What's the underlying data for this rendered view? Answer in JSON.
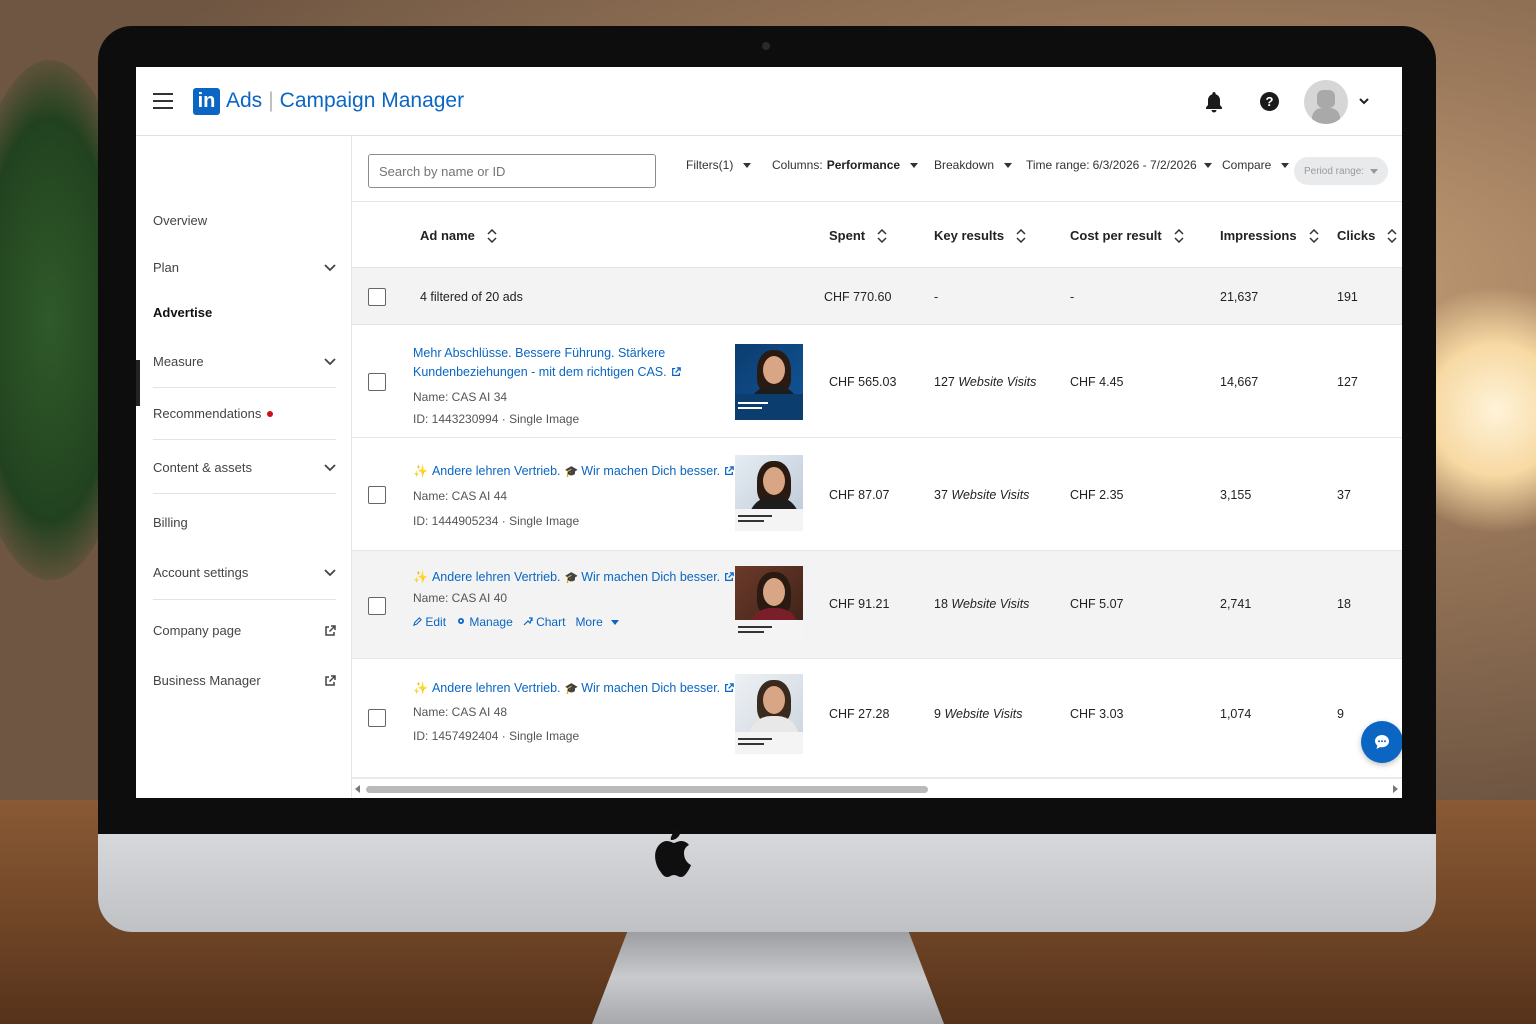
{
  "header": {
    "logo_text": "in",
    "brand_ads": "Ads",
    "brand_separator": "|",
    "brand_title": "Campaign Manager",
    "help_glyph": "?",
    "icons": [
      "menu-icon",
      "bell-icon",
      "help-icon",
      "avatar",
      "chevron-down-icon"
    ]
  },
  "sidebar": {
    "items": [
      {
        "label": "Overview"
      },
      {
        "label": "Plan"
      },
      {
        "label": "Advertise"
      },
      {
        "label": "Measure"
      },
      {
        "label": "Recommendations"
      },
      {
        "label": "Content & assets"
      },
      {
        "label": "Billing"
      },
      {
        "label": "Account settings"
      },
      {
        "label": "Company page"
      },
      {
        "label": "Business Manager"
      }
    ]
  },
  "toolbar": {
    "search_placeholder": "Search by name or ID",
    "filters": "Filters(1)",
    "columns_label": "Columns:",
    "columns_value": "Performance",
    "breakdown": "Breakdown",
    "time_range_label": "Time range:",
    "time_range_value": "6/3/2026 - 7/2/2026",
    "compare": "Compare",
    "period_range": "Period range:"
  },
  "table": {
    "headers": {
      "ad_name": "Ad name",
      "spent": "Spent",
      "key_results": "Key results",
      "cost_per_result": "Cost per result",
      "impressions": "Impressions",
      "clicks": "Clicks"
    },
    "summary": {
      "label": "4 filtered of 20 ads",
      "spent": "CHF 770.60",
      "key_results": "-",
      "cost_per_result": "-",
      "impressions": "21,637",
      "clicks": "191"
    },
    "rows": [
      {
        "title_line1": "Mehr Abschlüsse. Bessere Führung. Stärkere",
        "title_line2": "Kundenbeziehungen - mit dem richtigen CAS.",
        "name": "Name: CAS AI 34",
        "id": "ID: 1443230994 · Single Image",
        "spent": "CHF 565.03",
        "key_results_num": "127",
        "key_results_unit": "Website Visits",
        "cost_per_result": "CHF 4.45",
        "impressions": "14,667",
        "clicks": "127"
      },
      {
        "title_a": "Andere lehren Vertrieb.",
        "title_b": "Wir machen Dich besser.",
        "name": "Name: CAS AI 44",
        "id": "ID: 1444905234 · Single Image",
        "spent": "CHF 87.07",
        "key_results_num": "37",
        "key_results_unit": "Website Visits",
        "cost_per_result": "CHF 2.35",
        "impressions": "3,155",
        "clicks": "37"
      },
      {
        "title_a": "Andere lehren Vertrieb.",
        "title_b": "Wir machen Dich besser.",
        "name": "Name: CAS AI 40",
        "actions": {
          "edit": "Edit",
          "manage": "Manage",
          "chart": "Chart",
          "more": "More"
        },
        "spent": "CHF 91.21",
        "key_results_num": "18",
        "key_results_unit": "Website Visits",
        "cost_per_result": "CHF 5.07",
        "impressions": "2,741",
        "clicks": "18"
      },
      {
        "title_a": "Andere lehren Vertrieb.",
        "title_b": "Wir machen Dich besser.",
        "name": "Name: CAS AI 48",
        "id": "ID: 1457492404 · Single Image",
        "spent": "CHF 27.28",
        "key_results_num": "9",
        "key_results_unit": "Website Visits",
        "cost_per_result": "CHF 3.03",
        "impressions": "1,074",
        "clicks": "9"
      }
    ]
  },
  "colors": {
    "brand_blue": "#0a66c2",
    "notification_red": "#cc1016",
    "text_dark": "#222222"
  }
}
